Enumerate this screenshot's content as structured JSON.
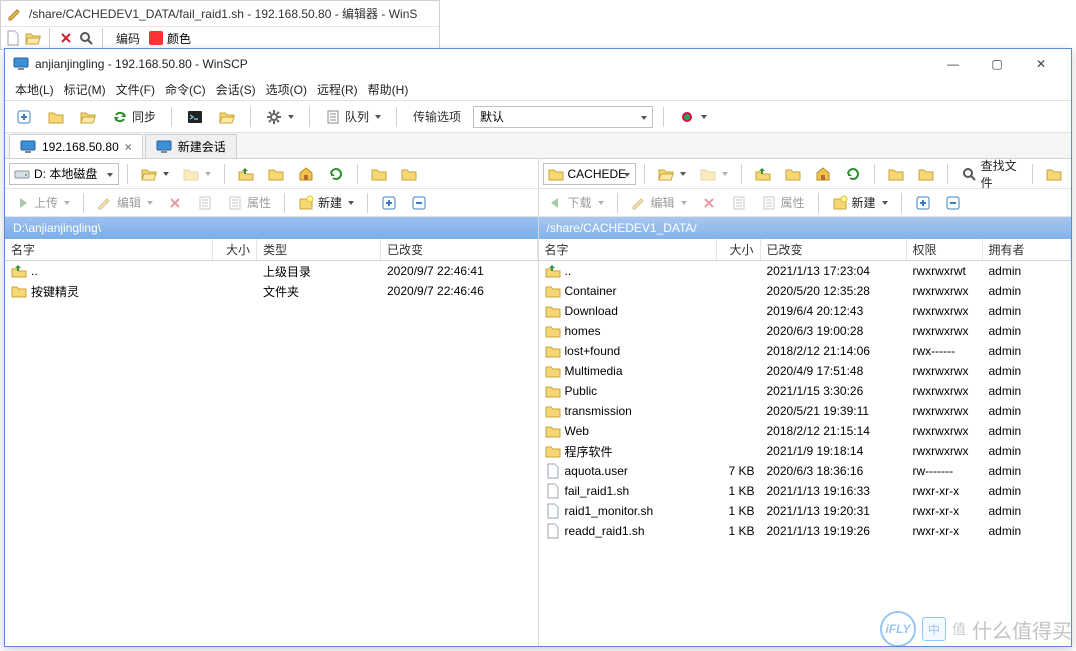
{
  "back_window": {
    "title": "/share/CACHEDEV1_DATA/fail_raid1.sh - 192.168.50.80 - 编辑器 - WinS",
    "encoding": "编码",
    "color": "颜色"
  },
  "main_window": {
    "title": "anjianjingling - 192.168.50.80 - WinSCP"
  },
  "menu": [
    "本地(L)",
    "标记(M)",
    "文件(F)",
    "命令(C)",
    "会话(S)",
    "选项(O)",
    "远程(R)",
    "帮助(H)"
  ],
  "toolbar": {
    "sync": "同步",
    "queue": "队列",
    "transfer_label": "传输选项",
    "transfer_value": "默认"
  },
  "tabs": {
    "session": "192.168.50.80",
    "new": "新建会话"
  },
  "local": {
    "drive": "D: 本地磁盘",
    "actions": {
      "upload": "上传",
      "edit": "编辑",
      "props": "属性",
      "new": "新建"
    },
    "path": "D:\\anjianjingling\\",
    "cols": {
      "name": "名字",
      "size": "大小",
      "type": "类型",
      "changed": "已改变"
    },
    "col_w": {
      "name": 208,
      "size": 44,
      "type": 124,
      "changed": 158
    },
    "rows": [
      {
        "name": "..",
        "icon": "up",
        "type": "上级目录",
        "changed": "2020/9/7  22:46:41"
      },
      {
        "name": "按键精灵",
        "icon": "folder",
        "type": "文件夹",
        "changed": "2020/9/7  22:46:46"
      }
    ]
  },
  "remote": {
    "drive": "CACHEDE",
    "actions": {
      "download": "下载",
      "edit": "编辑",
      "props": "属性",
      "new": "新建",
      "find": "查找文件"
    },
    "path": "/share/CACHEDEV1_DATA/",
    "cols": {
      "name": "名字",
      "size": "大小",
      "changed": "已改变",
      "rights": "权限",
      "owner": "拥有者"
    },
    "col_w": {
      "name": 178,
      "size": 44,
      "changed": 146,
      "rights": 76,
      "owner": 72
    },
    "rows": [
      {
        "name": "..",
        "icon": "up",
        "size": "",
        "changed": "2021/1/13 17:23:04",
        "rights": "rwxrwxrwt",
        "owner": "admin"
      },
      {
        "name": "Container",
        "icon": "folder",
        "size": "",
        "changed": "2020/5/20 12:35:28",
        "rights": "rwxrwxrwx",
        "owner": "admin"
      },
      {
        "name": "Download",
        "icon": "folder",
        "size": "",
        "changed": "2019/6/4 20:12:43",
        "rights": "rwxrwxrwx",
        "owner": "admin"
      },
      {
        "name": "homes",
        "icon": "folder",
        "size": "",
        "changed": "2020/6/3 19:00:28",
        "rights": "rwxrwxrwx",
        "owner": "admin"
      },
      {
        "name": "lost+found",
        "icon": "folder",
        "size": "",
        "changed": "2018/2/12 21:14:06",
        "rights": "rwx------",
        "owner": "admin"
      },
      {
        "name": "Multimedia",
        "icon": "folder",
        "size": "",
        "changed": "2020/4/9 17:51:48",
        "rights": "rwxrwxrwx",
        "owner": "admin"
      },
      {
        "name": "Public",
        "icon": "folder",
        "size": "",
        "changed": "2021/1/15 3:30:26",
        "rights": "rwxrwxrwx",
        "owner": "admin"
      },
      {
        "name": "transmission",
        "icon": "folder",
        "size": "",
        "changed": "2020/5/21 19:39:11",
        "rights": "rwxrwxrwx",
        "owner": "admin"
      },
      {
        "name": "Web",
        "icon": "folder",
        "size": "",
        "changed": "2018/2/12 21:15:14",
        "rights": "rwxrwxrwx",
        "owner": "admin"
      },
      {
        "name": "程序软件",
        "icon": "folder",
        "size": "",
        "changed": "2021/1/9 19:18:14",
        "rights": "rwxrwxrwx",
        "owner": "admin"
      },
      {
        "name": "aquota.user",
        "icon": "file",
        "size": "7 KB",
        "changed": "2020/6/3 18:36:16",
        "rights": "rw-------",
        "owner": "admin"
      },
      {
        "name": "fail_raid1.sh",
        "icon": "file",
        "size": "1 KB",
        "changed": "2021/1/13 19:16:33",
        "rights": "rwxr-xr-x",
        "owner": "admin"
      },
      {
        "name": "raid1_monitor.sh",
        "icon": "file",
        "size": "1 KB",
        "changed": "2021/1/13 19:20:31",
        "rights": "rwxr-xr-x",
        "owner": "admin"
      },
      {
        "name": "readd_raid1.sh",
        "icon": "file",
        "size": "1 KB",
        "changed": "2021/1/13 19:19:26",
        "rights": "rwxr-xr-x",
        "owner": "admin"
      }
    ]
  },
  "watermark": "什么值得买"
}
